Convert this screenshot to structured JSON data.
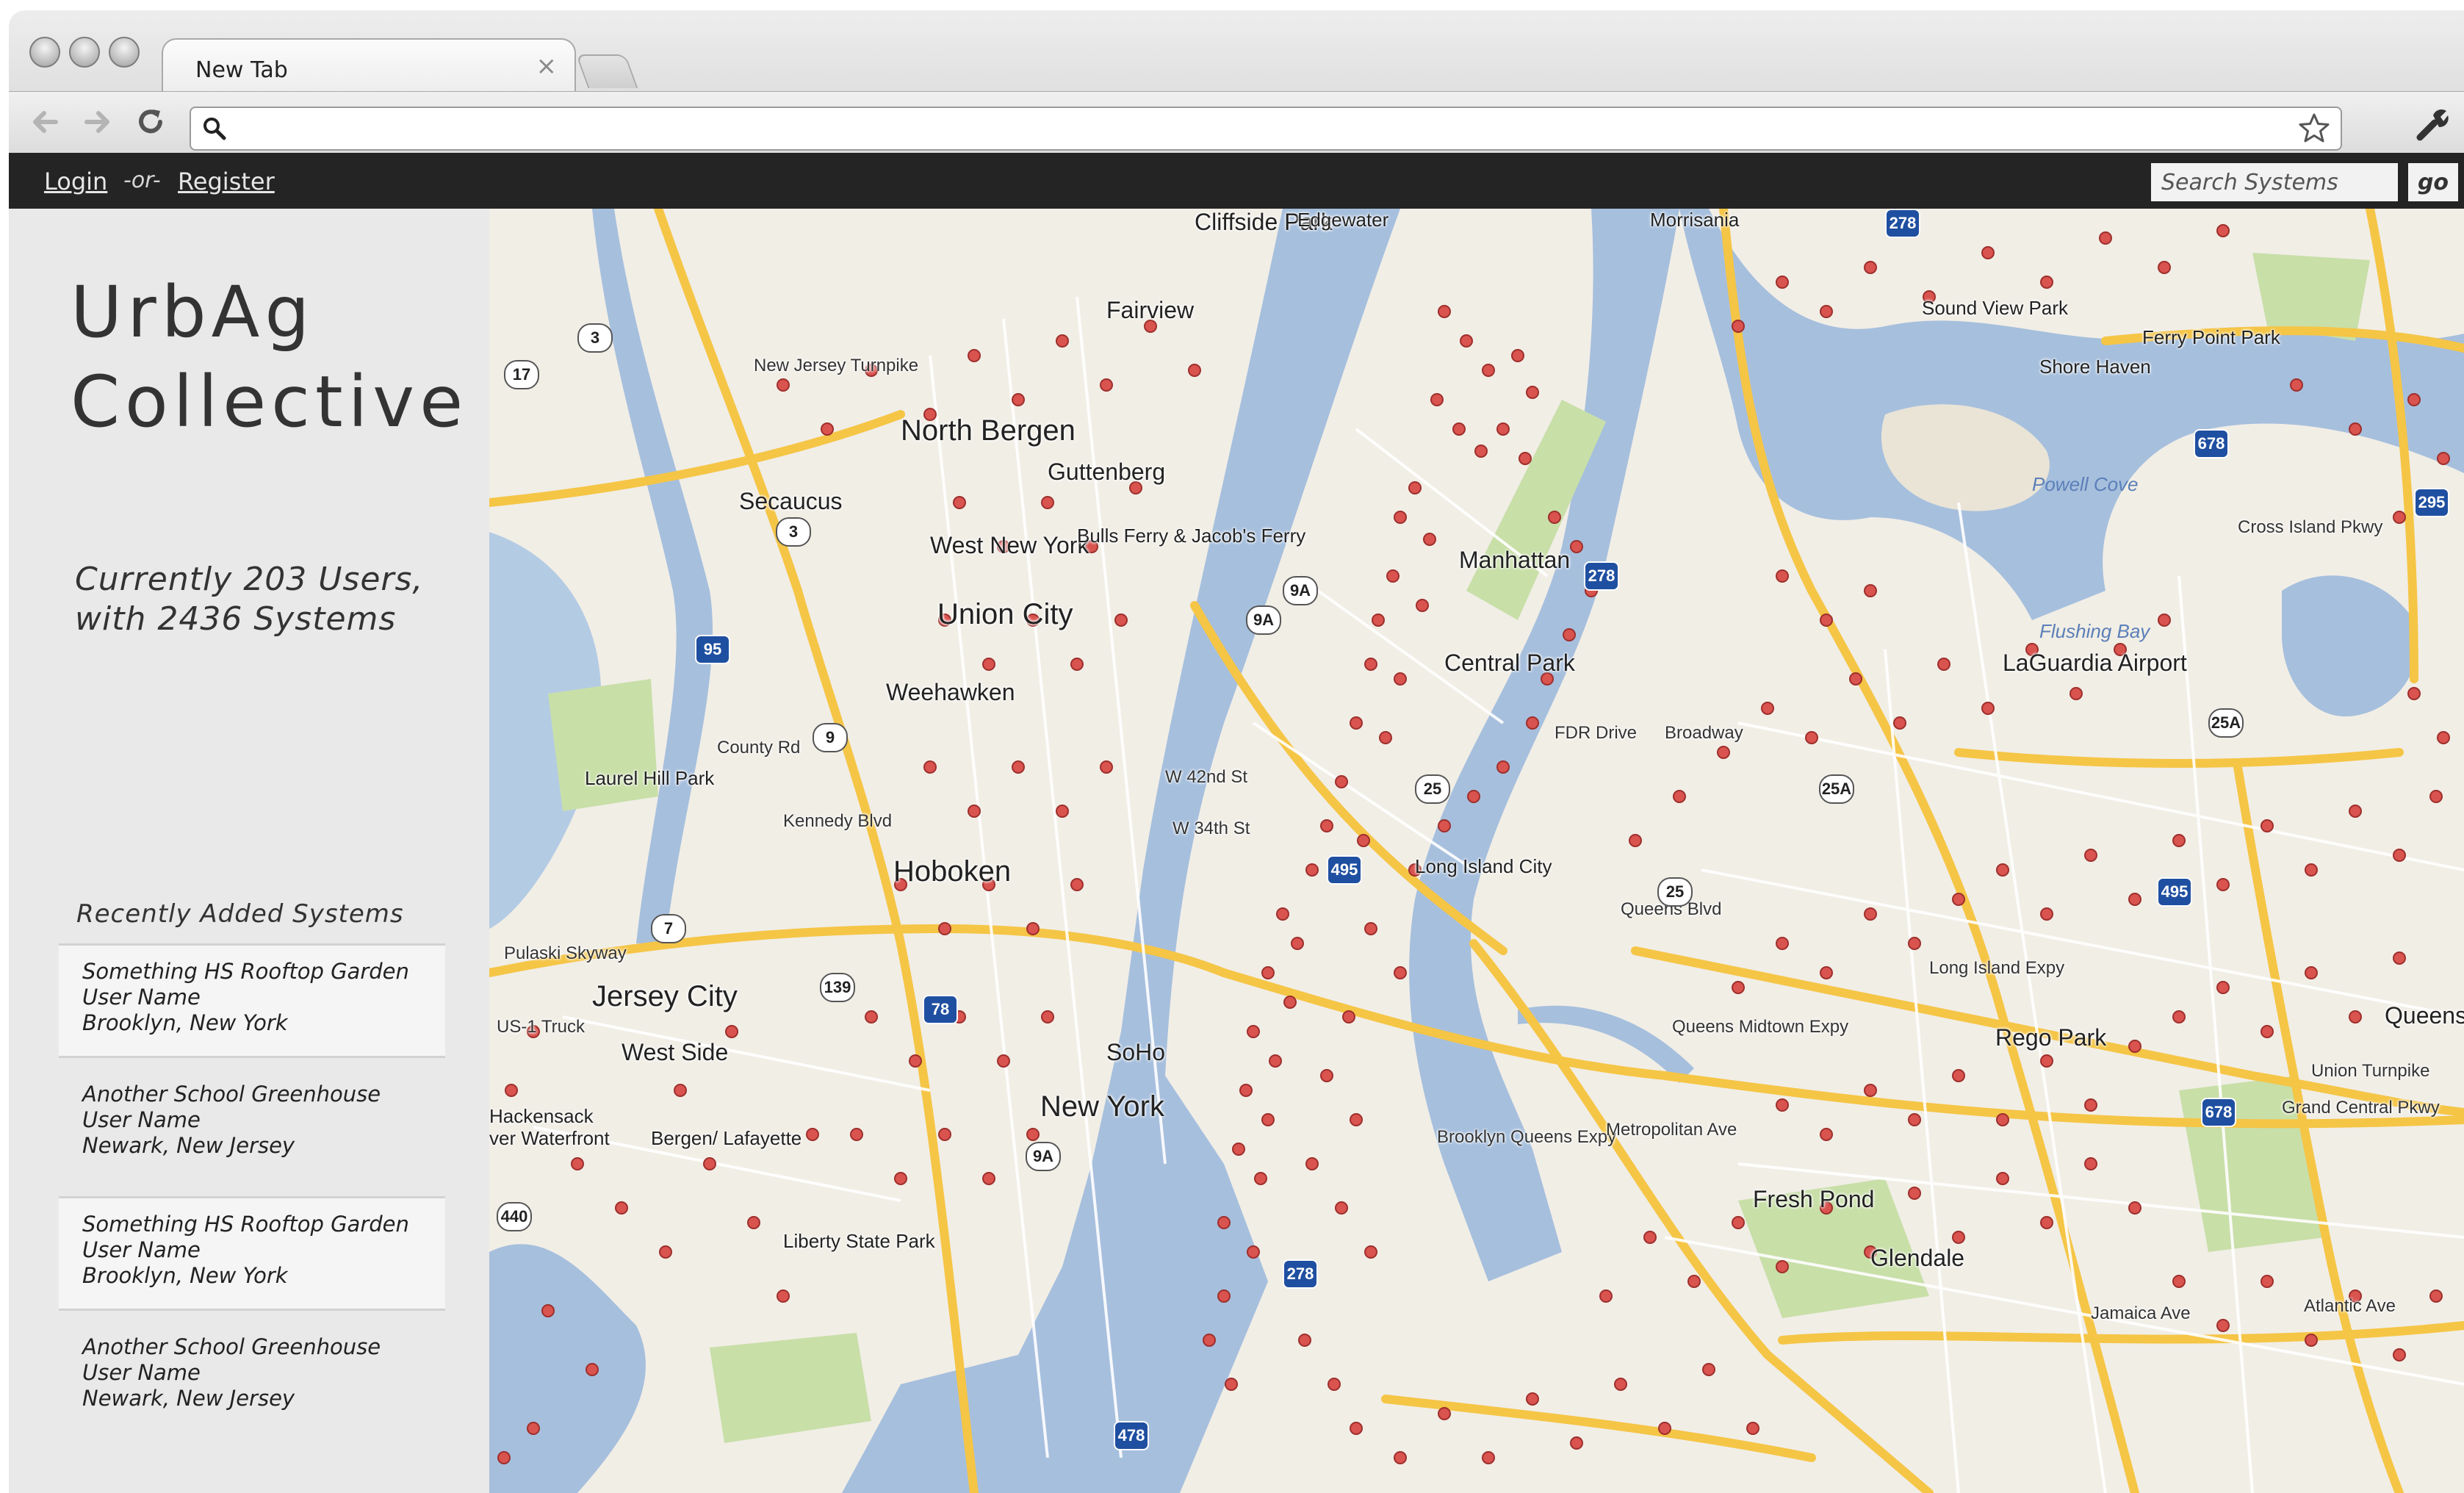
{
  "browser": {
    "tab_title": "New Tab",
    "tab_close": "×",
    "address": "",
    "icons": [
      "back-icon",
      "forward-icon",
      "reload-icon",
      "search-icon",
      "star-icon",
      "wrench-icon"
    ]
  },
  "topbar": {
    "login": "Login",
    "or": "-or-",
    "register": "Register",
    "search_placeholder": "Search Systems",
    "go": "go"
  },
  "sidebar": {
    "title_line1": "UrbAg",
    "title_line2": "Collective",
    "stats_line1": "Currently 203 Users,",
    "stats_line2": "with 2436 Systems",
    "recent_heading": "Recently Added Systems",
    "recent": [
      {
        "name": "Something HS Rooftop Garden",
        "user": "User Name",
        "location": "Brooklyn, New York"
      },
      {
        "name": "Another School Greenhouse",
        "user": "User Name",
        "location": "Newark, New Jersey"
      },
      {
        "name": "Something HS Rooftop Garden",
        "user": "User Name",
        "location": "Brooklyn, New York"
      },
      {
        "name": "Another School Greenhouse",
        "user": "User Name",
        "location": "Newark, New Jersey"
      }
    ]
  },
  "map": {
    "colors": {
      "water": "#a6bfdd",
      "land": "#f1eee6",
      "park": "#c8dfa8",
      "highway": "#f5c546",
      "marker": "#d9534f"
    },
    "labels": {
      "clifside_park": "Cliffside Park",
      "edgewater": "Edgewater",
      "morrisania": "Morrisania",
      "fairview": "Fairview",
      "north_bergen": "North Bergen",
      "guttenberg": "Guttenberg",
      "secaucus": "Secaucus",
      "west_new_york": "West New York",
      "bulls_ferry": "Bulls Ferry & Jacob's Ferry",
      "union_city": "Union City",
      "weehawken": "Weehawken",
      "manhattan": "Manhattan",
      "central_park": "Central Park",
      "hoboken": "Hoboken",
      "jersey_city": "Jersey City",
      "laurel_hill": "Laurel Hill Park",
      "west_side": "West Side",
      "bergen_lafayette": "Bergen/ Lafayette",
      "hackensack": "Hackensack",
      "river_waterfront": "ver Waterfront",
      "liberty_park": "Liberty State Park",
      "new_york": "New York",
      "soho": "SoHo",
      "long_island_city": "Long Island City",
      "laguardia": "LaGuardia Airport",
      "rego_park": "Rego Park",
      "fresh_pond": "Fresh Pond",
      "glendale": "Glendale",
      "queens": "Queens",
      "sound_view": "Sound View Park",
      "shore_haven": "Shore Haven",
      "ferry_point": "Ferry Point Park",
      "flushing_bay": "Flushing Bay",
      "powell_cove": "Powell Cove",
      "queens_blvd": "Queens Blvd",
      "queens_midtown": "Queens Midtown Expy",
      "long_island_expy": "Long Island Expy",
      "bqe": "Brooklyn Queens Expy",
      "fdr_drive": "FDR Drive",
      "broadway": "Broadway",
      "metropolitan": "Metropolitan Ave",
      "atlantic": "Atlantic Ave",
      "jamaica": "Jamaica Ave",
      "grand_central": "Grand Central Pkwy",
      "cross_island": "Cross Island Pkwy",
      "union_tpke": "Union Turnpike",
      "nj_tpke": "New Jersey Turnpike",
      "pulaski": "Pulaski Skyway",
      "w42": "W 42nd St",
      "w34": "W 34th St",
      "us1": "US-1 Truck",
      "county_rd": "County Rd",
      "kennedy": "Kennedy Blvd"
    },
    "shields": [
      "3",
      "17",
      "3",
      "95",
      "9",
      "7",
      "139",
      "78",
      "9A",
      "9A",
      "278",
      "278",
      "678",
      "295",
      "25A",
      "25",
      "495",
      "495",
      "678",
      "440",
      "278",
      "478",
      "25A",
      "25",
      "9A"
    ]
  }
}
